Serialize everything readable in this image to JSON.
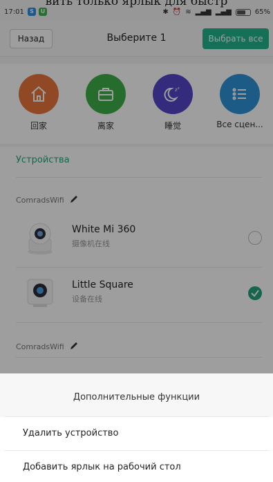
{
  "clipped_caption": "вить только ярлык для быстр",
  "status_bar": {
    "time": "17:01",
    "badge1": "S",
    "badge2": "U",
    "battery": "65%"
  },
  "header": {
    "back": "Назад",
    "title": "Выберите 1",
    "select_all": "Выбрать все"
  },
  "scenes": [
    {
      "label": "回家",
      "icon": "home-icon",
      "color": "#e8763a"
    },
    {
      "label": "离家",
      "icon": "briefcase-icon",
      "color": "#3dae4a"
    },
    {
      "label": "睡觉",
      "icon": "moon-zz-icon",
      "color": "#5546c9"
    },
    {
      "label": "Все сцен...",
      "icon": "list-icon",
      "color": "#2d93d8"
    }
  ],
  "devices": {
    "section_title": "Устройства",
    "groups": [
      {
        "name": "ComradsWifi",
        "items": [
          {
            "name": "White Mi 360",
            "status": "摄像机在线",
            "selected": false
          },
          {
            "name": "Little Square",
            "status": "设备在线",
            "selected": true
          }
        ]
      },
      {
        "name": "ComradsWifi",
        "items": []
      }
    ]
  },
  "sheet": {
    "header": "Дополнительные функции",
    "items": [
      "Удалить устройство",
      "Добавить ярлык на рабочий стол"
    ]
  },
  "colors": {
    "accent": "#22a57d",
    "select_all_bg": "#25b58d"
  }
}
